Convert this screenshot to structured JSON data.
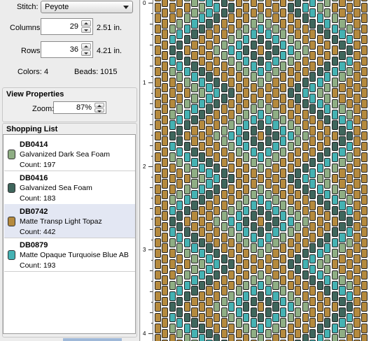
{
  "stitch": {
    "label": "Stitch:",
    "value": "Peyote"
  },
  "columns": {
    "label": "Columns:",
    "value": "29",
    "inches": "2.51 in."
  },
  "rows": {
    "label": "Rows:",
    "value": "36",
    "inches": "4.21 in."
  },
  "stats": {
    "colors_label": "Colors:",
    "colors_value": "4",
    "beads_label": "Beads:",
    "beads_value": "1015"
  },
  "view": {
    "title": "View Properties",
    "zoom_label": "Zoom:",
    "zoom_value": "87%"
  },
  "shopping": {
    "title": "Shopping List",
    "items": [
      {
        "code": "DB0414",
        "name": "Galvanized Dark Sea Foam",
        "count": "Count: 197",
        "color": "#8fae84",
        "selected": false
      },
      {
        "code": "DB0416",
        "name": "Galvanized Sea Foam",
        "count": "Count: 183",
        "color": "#3f665c",
        "selected": false
      },
      {
        "code": "DB0742",
        "name": "Matte Transp Light Topaz",
        "count": "Count: 442",
        "color": "#b58a3e",
        "selected": true
      },
      {
        "code": "DB0879",
        "name": "Matte Opaque Turquoise Blue AB",
        "count": "Count: 193",
        "color": "#45b2b3",
        "selected": false
      }
    ]
  },
  "ruler": {
    "labels": [
      "0",
      "1",
      "2",
      "3",
      "4"
    ]
  },
  "colors": {
    "selection": "#e3e7f3",
    "grid_bg": "#ffffff"
  }
}
